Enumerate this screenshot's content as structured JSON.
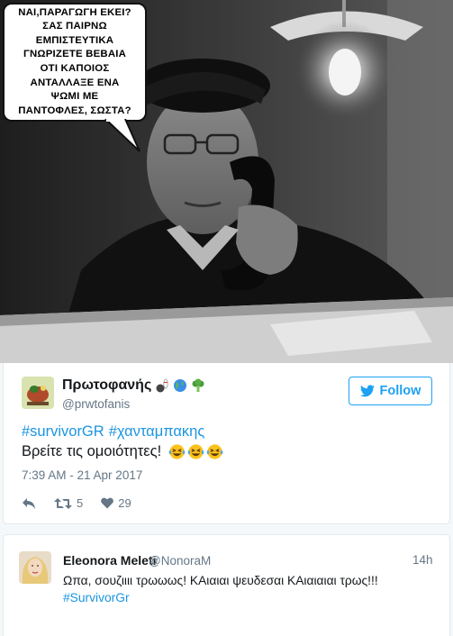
{
  "meme": {
    "bubble_text": "ΝΑΙ,ΠΑΡΑΓΩΓΗ ΕΚΕΙ?\nΣΑΣ ΠΑΙΡΝΩ\nΕΜΠΙΣΤΕΥΤΙΚΑ\nΓΝΩΡΙΖΕΤΕ ΒΕΒΑΙΑ\nΟΤΙ ΚΑΠΟΙΟΣ\nΑΝΤΑΛΛΑΞΕ ΕΝΑ\nΨΩΜΙ ΜΕ\nΠΑΝΤΟΦΛΕΣ, ΣΩΣΤΑ?"
  },
  "tweet": {
    "display_name": "Πρωτοφανής",
    "name_emojis": [
      "bowling-icon",
      "globe-icon",
      "broccoli-icon"
    ],
    "handle": "@prwtofanis",
    "follow_label": "Follow",
    "hashtags": [
      "#survivorGR",
      "#χανταμπακης"
    ],
    "text": "Βρείτε τις ομοιότητες!",
    "text_emojis": [
      "laughing-tears-icon",
      "laughing-tears-icon",
      "laughing-tears-icon"
    ],
    "timestamp": "7:39 AM - 21 Apr 2017",
    "retweet_count": "5",
    "like_count": "29",
    "accent_color": "#1da1f2"
  },
  "reply": {
    "display_name": "Eleonora Meleti",
    "handle": "@NonoraM",
    "time": "14h",
    "text": "Ωπα, σουζιιιι τρωωως! ΚΑιαιαι ψευδεσαι ΚΑιαιαιαι τρως!!!",
    "hashtag": "#SurvivorGr"
  }
}
